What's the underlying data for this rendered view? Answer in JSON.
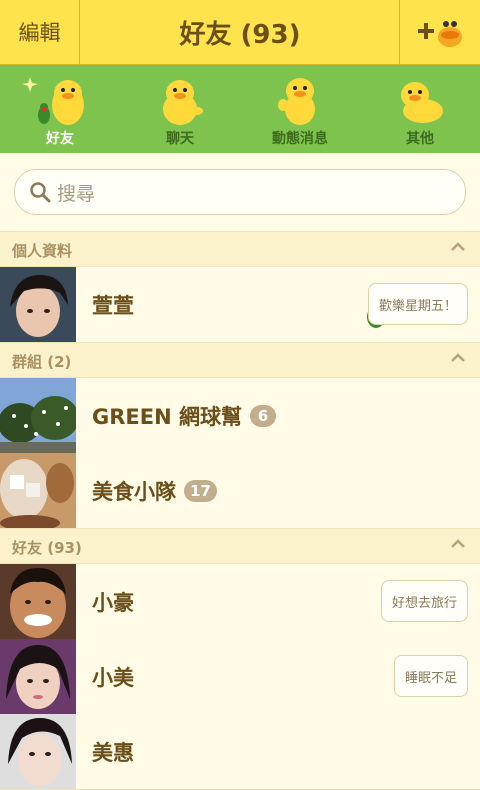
{
  "header": {
    "edit_label": "編輯",
    "title": "好友 (93)",
    "add_icon": "add-friend-icon"
  },
  "tabs": [
    {
      "label": "好友",
      "icon": "sally-friends-icon",
      "active": true
    },
    {
      "label": "聊天",
      "icon": "sally-chat-icon",
      "active": false
    },
    {
      "label": "動態消息",
      "icon": "sally-timeline-icon",
      "active": false
    },
    {
      "label": "其他",
      "icon": "sally-more-icon",
      "active": false
    }
  ],
  "search": {
    "placeholder": "搜尋",
    "icon": "search-icon"
  },
  "sections": {
    "profile": {
      "label": "個人資料"
    },
    "groups": {
      "label": "群組 (2)"
    },
    "friends": {
      "label": "好友 (93)"
    }
  },
  "profile": {
    "name": "萱萱",
    "status": "歡樂星期五！"
  },
  "groups": [
    {
      "name": "GREEN 網球幫",
      "count": "6"
    },
    {
      "name": "美食小隊",
      "count": "17"
    }
  ],
  "friends": [
    {
      "name": "小豪",
      "status": "好想去旅行"
    },
    {
      "name": "小美",
      "status": "睡眠不足"
    },
    {
      "name": "美惠",
      "status": ""
    }
  ],
  "colors": {
    "header_bg": "#ffe34d",
    "tab_bg": "#7ec34e",
    "list_bg": "#fffbe6",
    "section_bg": "#fbf2cc",
    "text_brown": "#6b4f1a"
  }
}
